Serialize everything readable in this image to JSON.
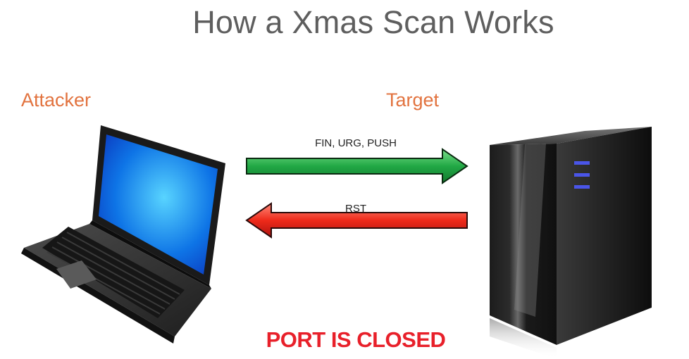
{
  "title": "How a Xmas Scan Works",
  "roles": {
    "attacker": "Attacker",
    "target": "Target"
  },
  "arrows": {
    "forward": {
      "label": "FIN, URG, PUSH",
      "color": "#1a9a3c"
    },
    "response": {
      "label": "RST",
      "color": "#e22318"
    }
  },
  "result": {
    "text": "PORT IS CLOSED",
    "color": "#e8202a"
  },
  "colors": {
    "title": "#5e5e5e",
    "role": "#e2733f"
  }
}
